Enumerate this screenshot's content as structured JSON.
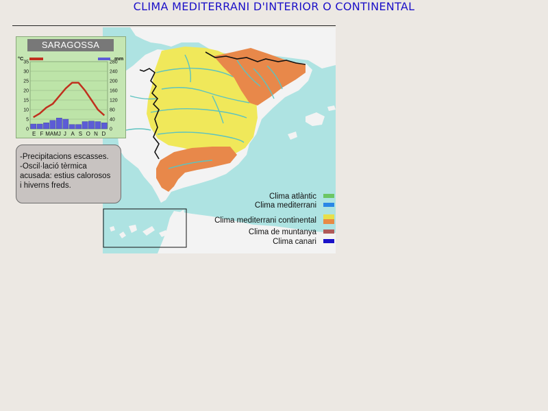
{
  "title": "CLIMA MEDITERRANI D'INTERIOR O CONTINENTAL",
  "climograph": {
    "city": "SARAGOSSA",
    "temp_unit": "°C",
    "precip_unit": "mm",
    "temp_ticks": [
      "35",
      "30",
      "25",
      "20",
      "15",
      "10",
      "5",
      "0"
    ],
    "precip_ticks": [
      "280",
      "240",
      "200",
      "160",
      "120",
      "80",
      "40",
      "0"
    ],
    "months": [
      "E",
      "F",
      "MA",
      "MJ",
      "J",
      "A",
      "S",
      "O",
      "N",
      "D"
    ],
    "temp_color": "#c0301e",
    "precip_color": "#5c5cd6"
  },
  "chart_data": {
    "type": "bar",
    "title": "SARAGOSSA",
    "categories": [
      "E",
      "F",
      "M",
      "A",
      "M",
      "J",
      "J",
      "A",
      "S",
      "O",
      "N",
      "D"
    ],
    "series": [
      {
        "values": [
          20,
          20,
          25,
          35,
          45,
          40,
          18,
          18,
          30,
          32,
          30,
          25
        ]
      },
      {
        "values": [
          6,
          8,
          11,
          13,
          17,
          21,
          24,
          24,
          20,
          15,
          10,
          7
        ]
      }
    ],
    "ylim_temp": [
      0,
      35
    ],
    "ylim_precip": [
      0,
      280
    ]
  },
  "notes": [
    "-Precipitacions escasses.",
    "-Oscil·lació tèrmica",
    "acusada: estius calorosos",
    "i hiverns freds."
  ],
  "legend": [
    {
      "label": "Clima atlàntic",
      "color": "#6cc664"
    },
    {
      "label": "Clima mediterrani",
      "color": "#2a87e6"
    },
    {
      "label": "Clima mediterrani continental",
      "color": "#e8df4a",
      "color2": "#e88a44"
    },
    {
      "label": "Clima de muntanya",
      "color": "#b05a58"
    },
    {
      "label": "Clima canari",
      "color": "#1a12c8"
    }
  ],
  "colors": {
    "sea": "#aee3e2",
    "land": "#f3f3f3",
    "continental_yellow": "#f0e85a",
    "continental_orange": "#e8884a",
    "river": "#5cc3c0",
    "border": "#111111"
  }
}
